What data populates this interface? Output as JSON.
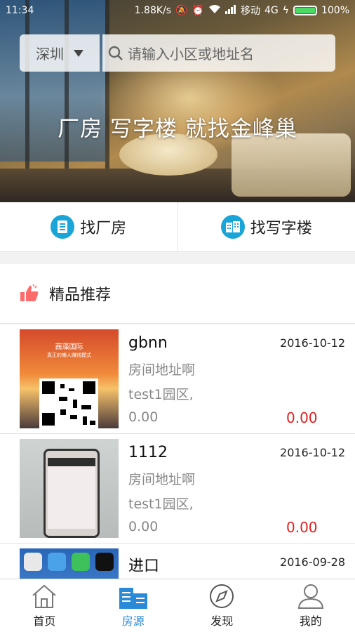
{
  "status_bar": {
    "time": "11:34",
    "network_speed": "1.88K/s",
    "carrier": "移动",
    "network_type": "4G",
    "battery": "100%"
  },
  "search": {
    "city": "深圳",
    "placeholder": "请输入小区或地址名"
  },
  "banner": {
    "slogan": "厂房 写字楼 就找金峰巢"
  },
  "categories": [
    {
      "label": "找厂房",
      "icon": "factory-doc-icon"
    },
    {
      "label": "找写字楼",
      "icon": "office-building-icon"
    }
  ],
  "recommended": {
    "title": "精品推荐",
    "icon": "thumbs-up-icon",
    "items": [
      {
        "title": "gbnn",
        "date": "2016-10-12",
        "address": "房间地址啊",
        "park": "test1园区,",
        "area": "0.00",
        "price": "0.00",
        "thumb_brand": "茜藻国际",
        "thumb_tagline": "真正的懒人赚钱模式"
      },
      {
        "title": "1112",
        "date": "2016-10-12",
        "address": "房间地址啊",
        "park": "test1园区,",
        "area": "0.00",
        "price": "0.00"
      },
      {
        "title": "进口",
        "date": "2016-09-28"
      }
    ]
  },
  "tabbar": {
    "tabs": [
      {
        "label": "首页",
        "icon": "home-icon",
        "active": false
      },
      {
        "label": "房源",
        "icon": "buildings-icon",
        "active": true
      },
      {
        "label": "发现",
        "icon": "compass-icon",
        "active": false
      },
      {
        "label": "我的",
        "icon": "person-icon",
        "active": false
      }
    ]
  },
  "colors": {
    "accent_blue": "#1aa5d8",
    "active_tab": "#2a8ad8",
    "price_red": "#e02020",
    "thumb_red": "#ff6b6b"
  }
}
